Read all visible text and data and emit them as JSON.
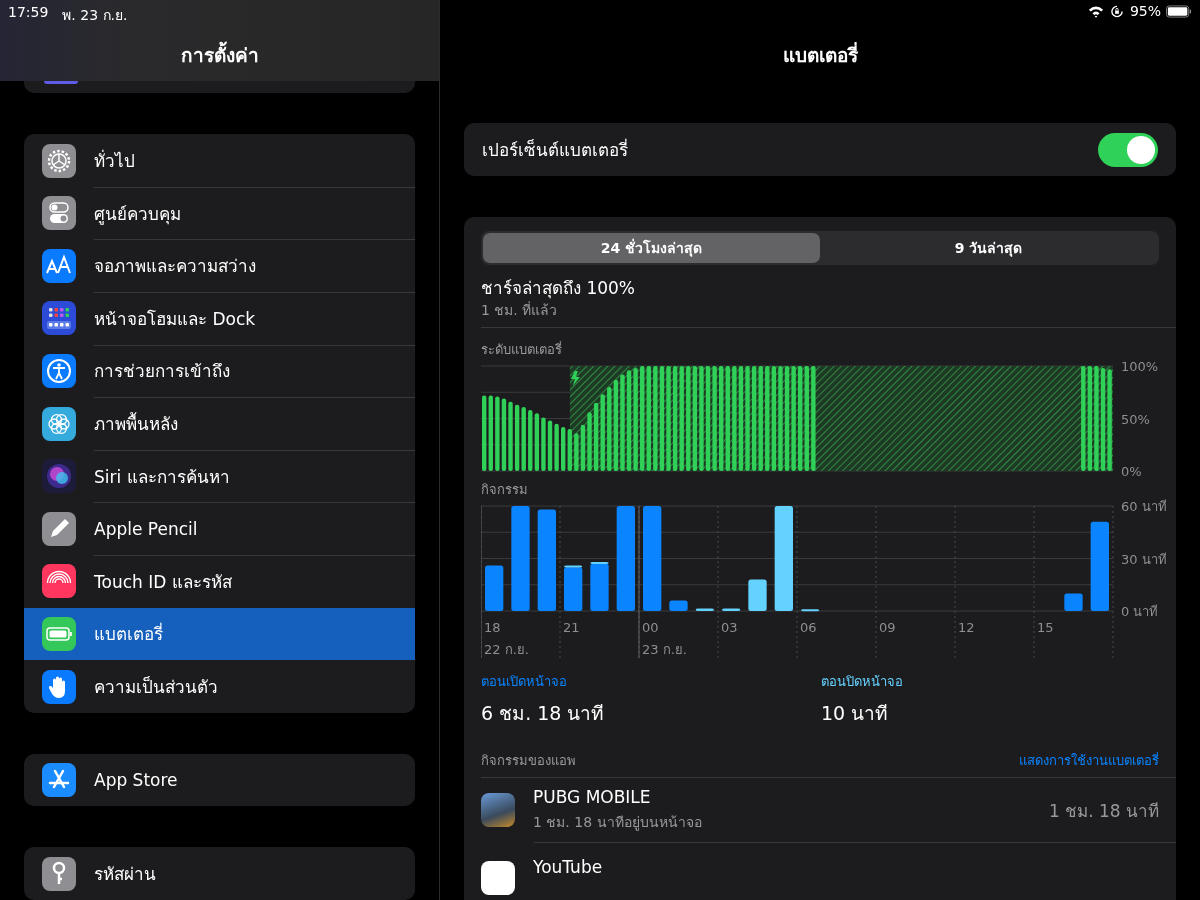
{
  "status_bar": {
    "time": "17:59",
    "date": "พ. 23 ก.ย.",
    "battery_percent": "95%"
  },
  "sidebar": {
    "title": "การตั้งค่า",
    "groups": [
      {
        "items": [
          {
            "label": "ทั่วไป",
            "kind": "gear",
            "color": "#8e8e93",
            "selected": false
          },
          {
            "label": "ศูนย์ควบคุม",
            "kind": "switches",
            "color": "#8e8e93",
            "selected": false
          },
          {
            "label": "จอภาพและความสว่าง",
            "kind": "text-size",
            "color": "#0a7aff",
            "selected": false
          },
          {
            "label": "หน้าจอโฮมและ Dock",
            "kind": "home-grid",
            "color": "#2c4bd6",
            "selected": false
          },
          {
            "label": "การช่วยการเข้าถึง",
            "kind": "accessibility",
            "color": "#0a7aff",
            "selected": false
          },
          {
            "label": "ภาพพื้นหลัง",
            "kind": "flower",
            "color": "#35aadc",
            "selected": false
          },
          {
            "label": "Siri และการค้นหา",
            "kind": "orb",
            "color": "#1c1c3a",
            "selected": false
          },
          {
            "label": "Apple Pencil",
            "kind": "pencil",
            "color": "#8e8e93",
            "selected": false
          },
          {
            "label": "Touch ID และรหัส",
            "kind": "fingerprint",
            "color": "#ff375f",
            "selected": false
          },
          {
            "label": "แบตเตอรี่",
            "kind": "battery",
            "color": "#34c759",
            "selected": true
          },
          {
            "label": "ความเป็นส่วนตัว",
            "kind": "hand",
            "color": "#0a7aff",
            "selected": false
          }
        ]
      },
      {
        "items": [
          {
            "label": "App Store",
            "kind": "app-store",
            "color": "#1a8cff",
            "selected": false
          }
        ]
      },
      {
        "items": [
          {
            "label": "รหัสผ่าน",
            "kind": "key",
            "color": "#8e8e93",
            "selected": false
          }
        ]
      }
    ]
  },
  "detail": {
    "title": "แบตเตอรี่",
    "percentage_toggle": {
      "label": "เปอร์เซ็นต์แบตเตอรี่",
      "on": true
    },
    "segments": [
      {
        "label": "24 ชั่วโมงล่าสุด",
        "selected": true
      },
      {
        "label": "9 วันล่าสุด",
        "selected": false
      }
    ],
    "last_charge": {
      "title": "ชาร์จล่าสุดถึง 100%",
      "subtitle": "1 ชม. ที่แล้ว"
    },
    "battery_level": {
      "chart_data": {
        "type": "bar",
        "ylim": [
          0,
          100
        ],
        "yticks": [
          {
            "value": 0,
            "label": "0%"
          },
          {
            "value": 50,
            "label": "50%"
          },
          {
            "value": 100,
            "label": "100%"
          }
        ],
        "series": [
          {
            "name": "ระดับแบตเตอรี่",
            "color": "#30d158",
            "values": [
              72,
              72,
              71,
              69,
              66,
              63,
              61,
              58,
              55,
              51,
              48,
              45,
              42,
              40,
              36,
              44,
              56,
              65,
              73,
              80,
              87,
              92,
              96,
              98,
              100,
              100,
              100,
              100,
              100,
              100,
              100,
              100,
              100,
              100,
              100,
              100,
              100,
              100,
              100,
              100,
              100,
              100,
              100,
              100,
              100,
              100,
              100,
              100,
              100,
              100,
              100,
              null,
              null,
              null,
              null,
              null,
              null,
              null,
              null,
              null,
              null,
              null,
              null,
              null,
              null,
              null,
              null,
              null,
              null,
              null,
              null,
              null,
              null,
              null,
              null,
              null,
              null,
              null,
              null,
              null,
              null,
              null,
              null,
              null,
              null,
              null,
              null,
              null,
              null,
              null,
              null,
              100,
              100,
              100,
              98,
              97
            ]
          }
        ]
      }
    },
    "activity": {
      "label": "กิจกรรม",
      "chart_data": {
        "type": "bar",
        "stacked": true,
        "categories": [
          "18",
          null,
          null,
          "21",
          null,
          null,
          "00",
          null,
          null,
          "03",
          null,
          null,
          "06",
          null,
          null,
          "09",
          null,
          null,
          "12",
          null,
          null,
          "15",
          null,
          null
        ],
        "ylim": [
          0,
          60
        ],
        "yticks": [
          {
            "value": 0,
            "label": "0 นาที"
          },
          {
            "value": 30,
            "label": "30 นาที"
          },
          {
            "value": 60,
            "label": "60 นาที"
          }
        ],
        "series": [
          {
            "name": "ตอนเปิดหน้าจอ",
            "color": "#0a84ff",
            "values": [
              26,
              60,
              58,
              25,
              27,
              60,
              60,
              6,
              0,
              0,
              0,
              0,
              0,
              0,
              0,
              0,
              0,
              0,
              0,
              0,
              0,
              0,
              10,
              51
            ]
          },
          {
            "name": "ตอนปิดหน้าจอ",
            "color": "#64d2ff",
            "values": [
              0,
              0,
              0,
              1,
              1,
              0,
              0,
              0,
              1.5,
              1.5,
              18,
              60,
              1,
              0,
              0,
              0,
              0,
              0,
              0,
              0,
              0,
              0,
              0,
              0
            ]
          }
        ]
      },
      "date_labels": [
        "22 ก.ย.",
        "23 ก.ย."
      ]
    },
    "stats": [
      {
        "value": "6 ชม. 18 นาที"
      },
      {
        "value": "10 นาที"
      }
    ],
    "app_activity": {
      "label": "กิจกรรมของแอพ",
      "link": "แสดงการใช้งานแบตเตอรี่",
      "apps": [
        {
          "name": "PUBG MOBILE",
          "detail": "1 ชม. 18 นาทีอยู่บนหน้าจอ",
          "usage": "1 ชม. 18 นาที"
        },
        {
          "name": "YouTube"
        }
      ]
    }
  }
}
